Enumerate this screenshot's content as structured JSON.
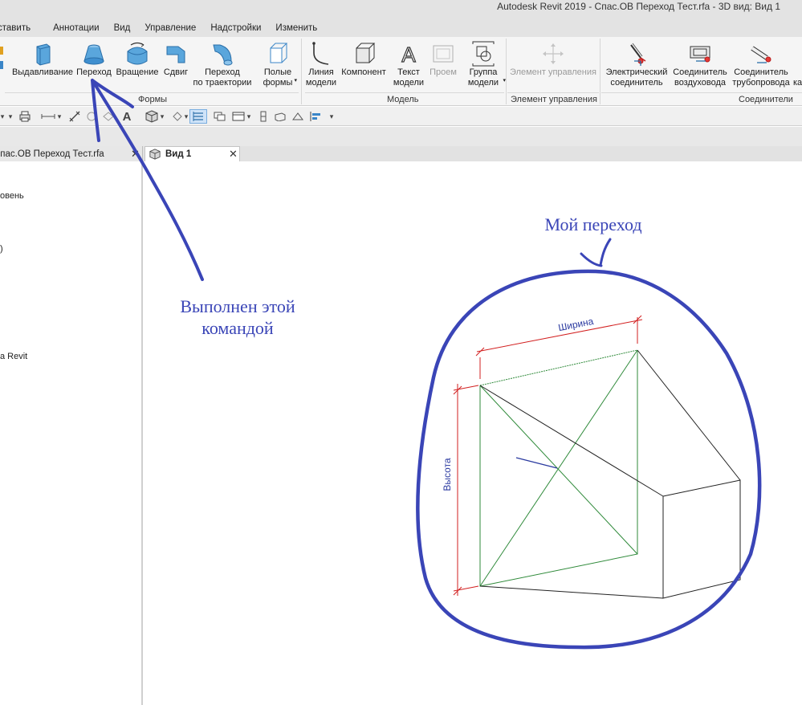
{
  "window": {
    "title": "Autodesk Revit 2019 - Спас.ОВ Переход Тест.rfa - 3D вид: Вид 1"
  },
  "menu_tabs": [
    "ставить",
    "Аннотации",
    "Вид",
    "Управление",
    "Надстройки",
    "Изменить"
  ],
  "ribbon": {
    "forms": {
      "label": "Формы",
      "buttons": {
        "extrusion": "Выдавливание",
        "blend": "Переход",
        "revolve": "Вращение",
        "sweep": "Сдвиг",
        "swept_blend_1": "Переход",
        "swept_blend_2": "по траектории",
        "void_1": "Полые",
        "void_2": "формы"
      }
    },
    "model": {
      "label": "Модель",
      "buttons": {
        "model_line_1": "Линия",
        "model_line_2": "модели",
        "component": "Компонент",
        "model_text_1": "Текст",
        "model_text_2": "модели",
        "opening": "Проем",
        "model_group_1": "Группа",
        "model_group_2": "модели"
      }
    },
    "control": {
      "label": "Элемент управления",
      "buttons": {
        "control": "Элемент управления"
      }
    },
    "connectors": {
      "label": "Соединители",
      "buttons": {
        "electrical_1": "Электрический",
        "electrical_2": "соединитель",
        "duct_1": "Соединитель",
        "duct_2": "воздуховода",
        "pipe_1": "Соединитель",
        "pipe_2": "трубопровода",
        "cut": "ка"
      }
    }
  },
  "doc_tabs": {
    "left": "Спас.ОВ Переход Тест.rfa",
    "view": "Вид 1"
  },
  "project_browser": {
    "items": [
      "овень",
      ")",
      "а Revit"
    ]
  },
  "viewport": {
    "width_label": "Ширина",
    "height_label": "Высота"
  },
  "annotations": {
    "my_blend": "Мой переход",
    "done_line1": "Выполнен этой",
    "done_line2": "командой"
  },
  "colors": {
    "ink": "#3a45b7",
    "dim": "#d21f1f",
    "green": "#2f8a3a",
    "tag": "#2b3aa0"
  }
}
